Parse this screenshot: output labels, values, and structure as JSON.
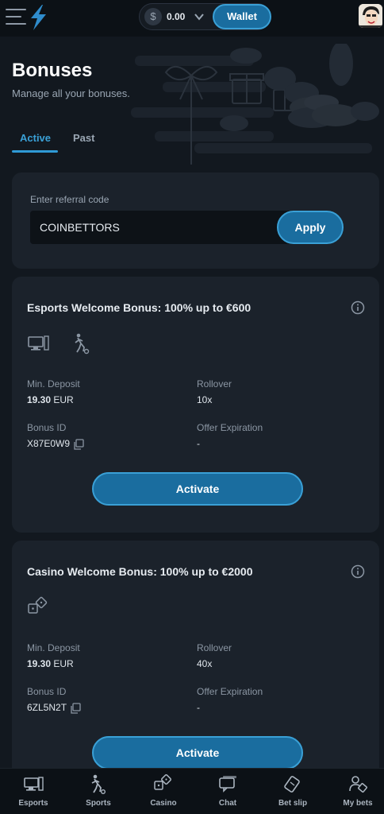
{
  "topbar": {
    "balance": "0.00",
    "currency_symbol": "$",
    "wallet_label": "Wallet"
  },
  "page": {
    "title": "Bonuses",
    "subtitle": "Manage all your bonuses."
  },
  "tabs": [
    {
      "label": "Active",
      "active": true
    },
    {
      "label": "Past",
      "active": false
    }
  ],
  "referral": {
    "label": "Enter referral code",
    "value": "COINBETTORS",
    "apply_label": "Apply"
  },
  "bonuses": [
    {
      "title": "Esports Welcome Bonus: 100% up to €600",
      "icons": [
        "esports-icon",
        "sports-icon"
      ],
      "min_deposit_label": "Min. Deposit",
      "min_deposit_amount": "19.30",
      "min_deposit_currency": "EUR",
      "rollover_label": "Rollover",
      "rollover_value": "10x",
      "bonus_id_label": "Bonus ID",
      "bonus_id": "X87E0W9",
      "expiration_label": "Offer Expiration",
      "expiration_value": "-",
      "activate_label": "Activate"
    },
    {
      "title": "Casino Welcome Bonus: 100% up to €2000",
      "icons": [
        "casino-dice-icon"
      ],
      "min_deposit_label": "Min. Deposit",
      "min_deposit_amount": "19.30",
      "min_deposit_currency": "EUR",
      "rollover_label": "Rollover",
      "rollover_value": "40x",
      "bonus_id_label": "Bonus ID",
      "bonus_id": "6ZL5N2T",
      "expiration_label": "Offer Expiration",
      "expiration_value": "-",
      "activate_label": "Activate"
    }
  ],
  "bottom_nav": [
    {
      "label": "Esports",
      "icon": "esports-icon"
    },
    {
      "label": "Sports",
      "icon": "sports-icon"
    },
    {
      "label": "Casino",
      "icon": "casino-icon"
    },
    {
      "label": "Chat",
      "icon": "chat-icon"
    },
    {
      "label": "Bet slip",
      "icon": "bet-slip-icon"
    },
    {
      "label": "My bets",
      "icon": "my-bets-icon"
    }
  ],
  "colors": {
    "background": "#12181f",
    "card": "#1b222b",
    "accent": "#3aa0d6",
    "button": "#1a6d9f"
  }
}
